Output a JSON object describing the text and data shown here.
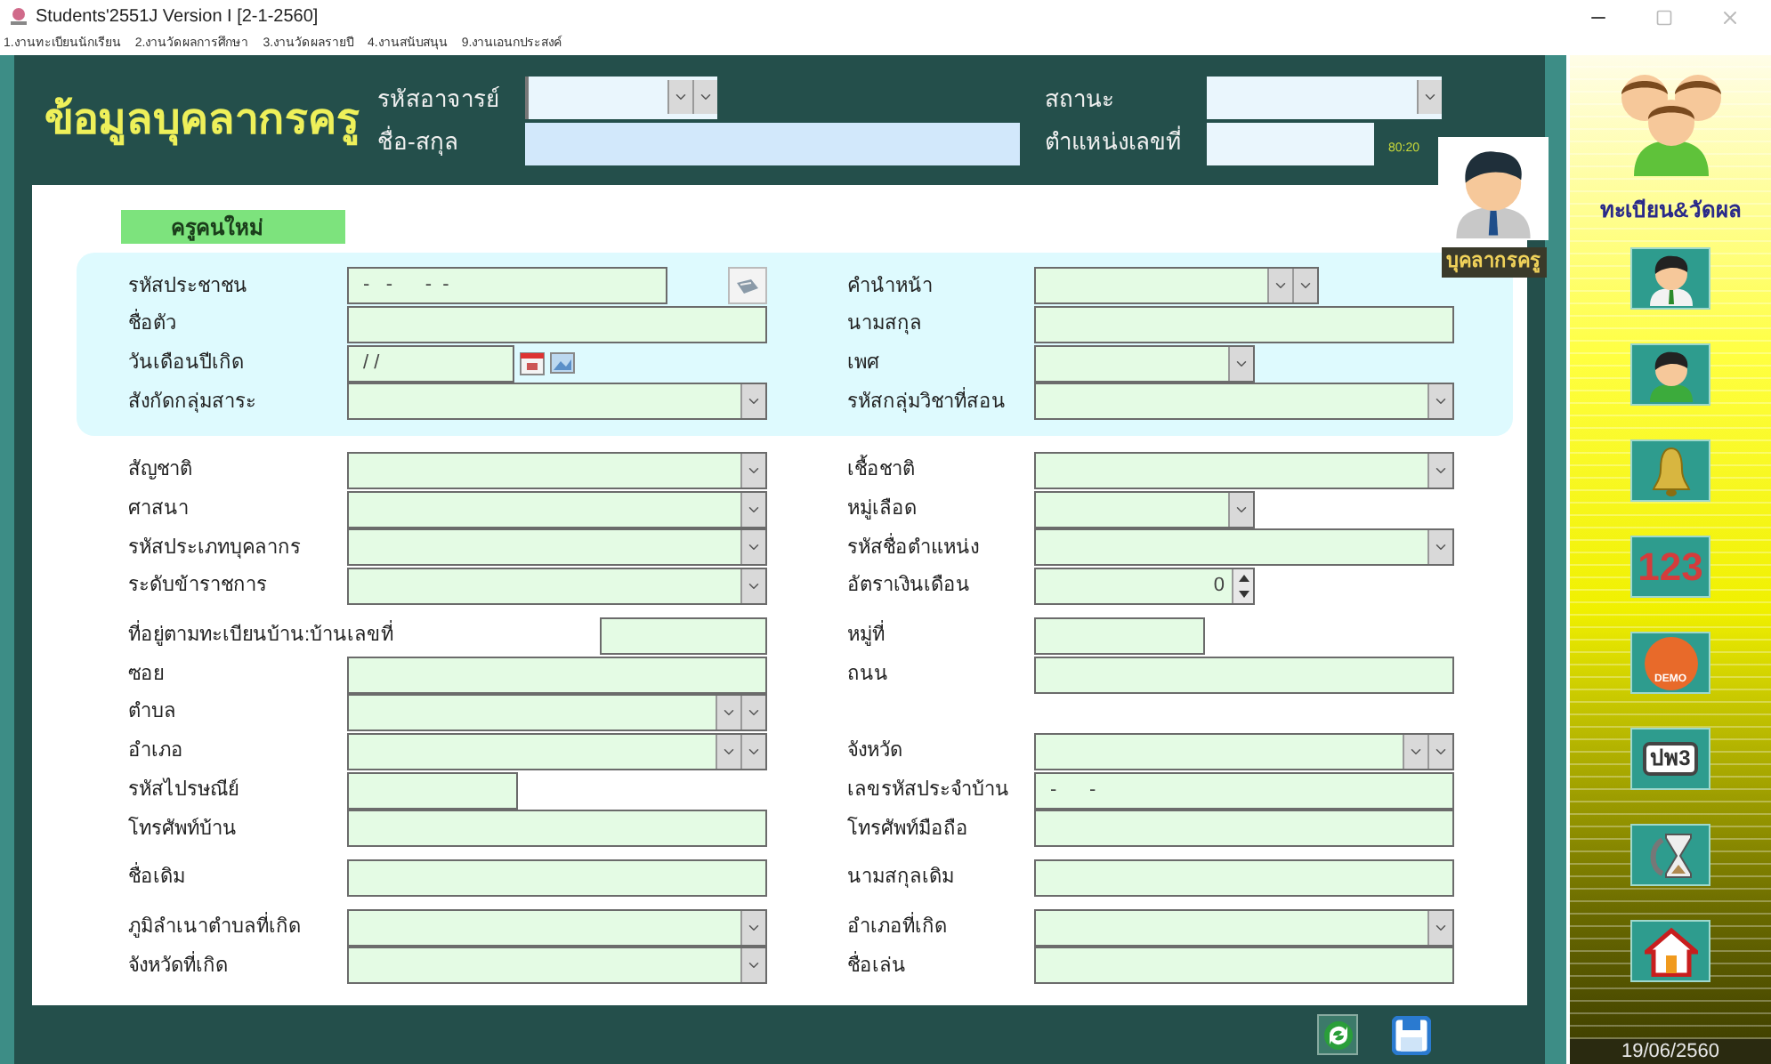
{
  "window": {
    "title": "Students'2551J Version I [2-1-2560]"
  },
  "menu": [
    "1.งานทะเบียนนักเรียน",
    "2.งานวัดผลการศึกษา",
    "3.งานวัดผลรายปี",
    "4.งานสนับสนุน",
    "9.งานเอนกประสงค์"
  ],
  "header": {
    "title": "ข้อมูลบุคลากรครู",
    "teacher_code_label": "รหัสอาจารย์",
    "name_label": "ชื่อ-สกุล",
    "status_label": "สถานะ",
    "position_no_label": "ตำแหน่งเลขที่",
    "ratio": "80:20"
  },
  "photo_label": "บุคลากรครู",
  "new_teacher_badge": "ครูคนใหม่",
  "groups": [
    {
      "kind": "highlight",
      "rows": [
        {
          "left": {
            "label": "รหัสประชาชน",
            "kind": "id-card",
            "value": "-   -      -  -"
          },
          "right": {
            "label": "คำนำหน้า",
            "kind": "short-double-combo"
          }
        },
        {
          "left": {
            "label": "ชื่อตัว",
            "kind": "text"
          },
          "right": {
            "label": "นามสกุล",
            "kind": "text"
          }
        },
        {
          "left": {
            "label": "วันเดือนปีเกิด",
            "kind": "date",
            "value": "/ /"
          },
          "right": {
            "label": "เพศ",
            "kind": "short-combo"
          }
        },
        {
          "left": {
            "label": "สังกัดกลุ่มสาระ",
            "kind": "combo"
          },
          "right": {
            "label": "รหัสกลุ่มวิชาที่สอน",
            "kind": "combo"
          }
        }
      ]
    },
    {
      "kind": "plain",
      "rows": [
        {
          "left": {
            "label": "สัญชาติ",
            "kind": "combo"
          },
          "right": {
            "label": "เชื้อชาติ",
            "kind": "combo"
          }
        },
        {
          "left": {
            "label": "ศาสนา",
            "kind": "combo"
          },
          "right": {
            "label": "หมู่เลือด",
            "kind": "short-combo"
          }
        },
        {
          "left": {
            "label": "รหัสประเภทบุคลากร",
            "kind": "combo"
          },
          "right": {
            "label": "รหัสชื่อตำแหน่ง",
            "kind": "combo"
          }
        },
        {
          "left": {
            "label": "ระดับข้าราชการ",
            "kind": "combo"
          },
          "right": {
            "label": "อัตราเงินเดือน",
            "kind": "spin",
            "value": "0"
          }
        }
      ]
    },
    {
      "kind": "plain",
      "rows": [
        {
          "left": {
            "label": "ที่อยู่ตามทะเบียนบ้าน:บ้านเลขที่",
            "kind": "short-text-end"
          },
          "right": {
            "label": "หมู่ที่",
            "kind": "short-text"
          }
        },
        {
          "left": {
            "label": "ซอย",
            "kind": "text"
          },
          "right": {
            "label": "ถนน",
            "kind": "text"
          }
        },
        {
          "left": {
            "label": "ตำบล",
            "kind": "double-combo"
          }
        },
        {
          "left": {
            "label": "อำเภอ",
            "kind": "double-combo"
          },
          "right": {
            "label": "จังหวัด",
            "kind": "double-combo"
          }
        },
        {
          "left": {
            "label": "รหัสไปรษณีย์",
            "kind": "short-text"
          },
          "right": {
            "label": "เลขรหัสประจำบ้าน",
            "kind": "masked",
            "value": "-      -"
          }
        },
        {
          "left": {
            "label": "โทรศัพท์บ้าน",
            "kind": "text"
          },
          "right": {
            "label": "โทรศัพท์มือถือ",
            "kind": "text"
          }
        }
      ]
    },
    {
      "kind": "plain",
      "rows": [
        {
          "left": {
            "label": "ชื่อเดิม",
            "kind": "text"
          },
          "right": {
            "label": "นามสกุลเดิม",
            "kind": "text"
          }
        }
      ]
    },
    {
      "kind": "plain",
      "rows": [
        {
          "left": {
            "label": "ภูมิลำเนาตำบลที่เกิด",
            "kind": "combo"
          },
          "right": {
            "label": "อำเภอที่เกิด",
            "kind": "combo"
          }
        },
        {
          "left": {
            "label": "จังหวัดที่เกิด",
            "kind": "combo"
          },
          "right": {
            "label": "ชื่อเล่น",
            "kind": "text"
          }
        }
      ]
    }
  ],
  "sidebar": {
    "title": "ทะเบียน&วัดผล",
    "buttons": [
      {
        "kind": "teacher"
      },
      {
        "kind": "student"
      },
      {
        "kind": "bell"
      },
      {
        "kind": "numbers",
        "text": "123"
      },
      {
        "kind": "demo",
        "text": "DEMO"
      },
      {
        "kind": "form",
        "text": "ปพ3"
      },
      {
        "kind": "history"
      },
      {
        "kind": "home"
      }
    ],
    "date": "19/06/2560"
  }
}
